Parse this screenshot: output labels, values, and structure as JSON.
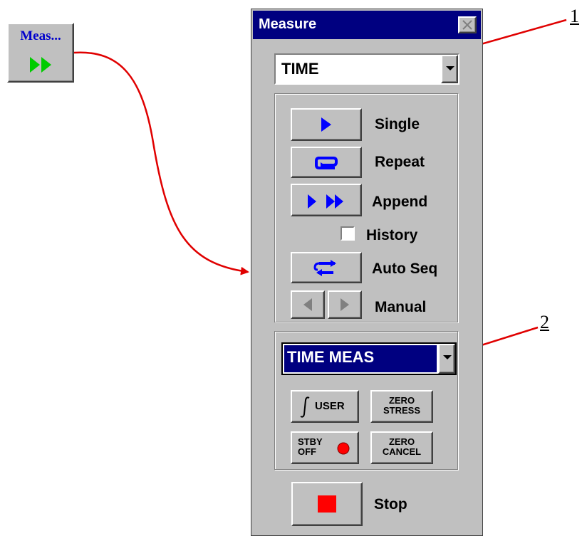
{
  "toolbar_button": {
    "label": "Meas...",
    "icon": "fast-forward-icon"
  },
  "callouts": {
    "one": "1",
    "two": "2"
  },
  "window": {
    "title": "Measure",
    "close_icon": "close-icon",
    "mode_combo": {
      "value": "TIME"
    },
    "measure_buttons": {
      "single": "Single",
      "repeat": "Repeat",
      "append": "Append",
      "history": "History",
      "history_checked": false,
      "auto_seq": "Auto Seq",
      "manual": "Manual"
    },
    "measurement_combo": {
      "value": "TIME MEAS"
    },
    "function_buttons": {
      "user": "USER",
      "zero_stress_1": "ZERO",
      "zero_stress_2": "STRESS",
      "stby_1": "STBY",
      "stby_2": "OFF",
      "zero_cancel_1": "ZERO",
      "zero_cancel_2": "CANCEL"
    },
    "stop": "Stop"
  },
  "colors": {
    "title_bar": "#000080",
    "icon_blue": "#0000ff",
    "icon_green": "#00cc00",
    "arrow_red": "#e00000",
    "stop_red": "#ff0000"
  }
}
